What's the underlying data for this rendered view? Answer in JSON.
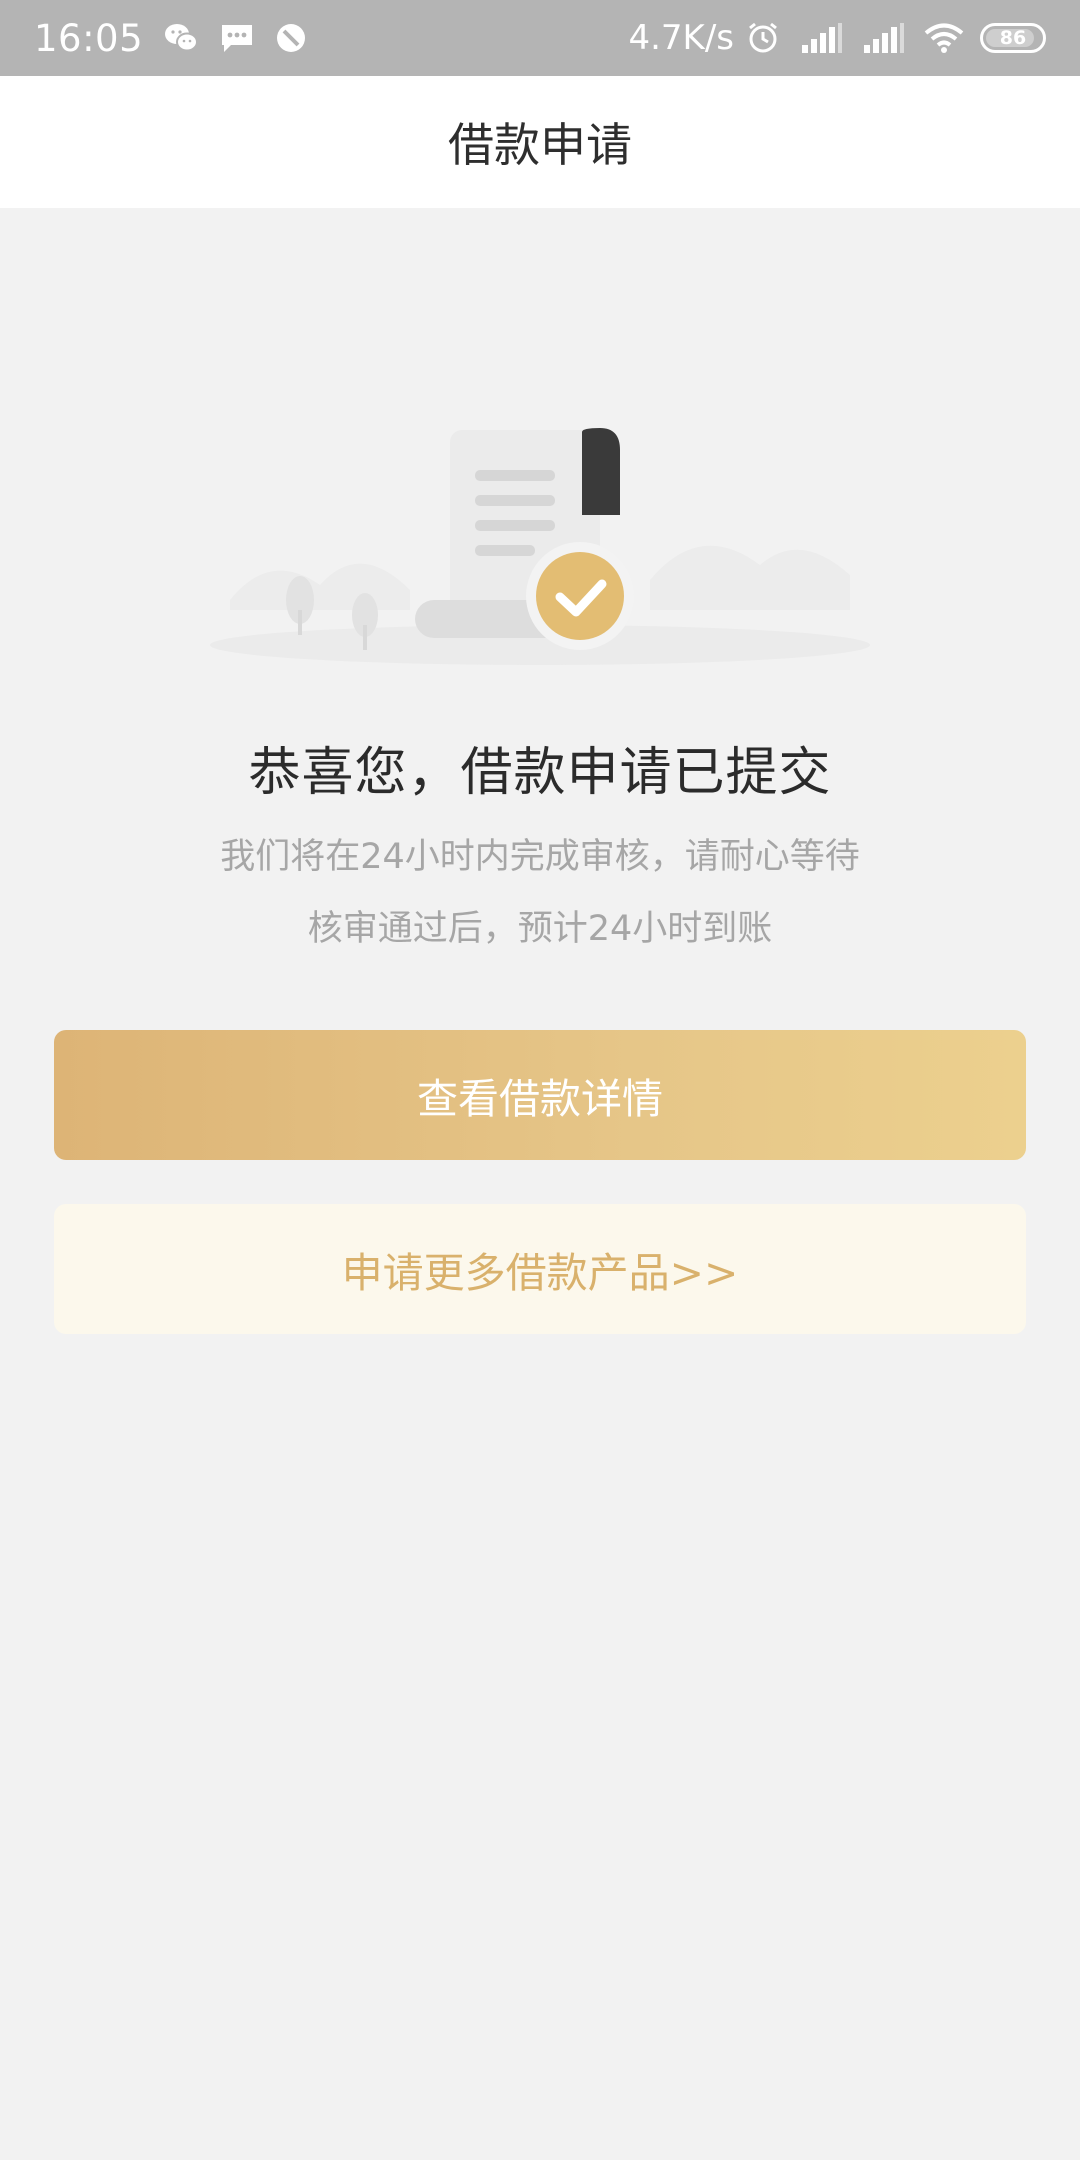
{
  "status_bar": {
    "time": "16:05",
    "net_speed": "4.7K/s",
    "battery": "86",
    "left_icons": [
      "wechat-icon",
      "message-icon",
      "do-not-disturb-icon"
    ],
    "right_icons": [
      "alarm-icon",
      "signal-icon",
      "signal-icon",
      "wifi-icon",
      "battery-icon"
    ]
  },
  "nav": {
    "title": "借款申请"
  },
  "result": {
    "headline": "恭喜您，借款申请已提交",
    "line1": "我们将在24小时内完成审核，请耐心等待",
    "line2": "核审通过后，预计24小时到账"
  },
  "actions": {
    "primary_label": "查看借款详情",
    "secondary_label": "申请更多借款产品>>"
  },
  "colors": {
    "accent": "#e2bd7f",
    "accent_light": "#fcf8ec",
    "status_bar": "#b4b4b4",
    "background": "#f2f2f2"
  }
}
